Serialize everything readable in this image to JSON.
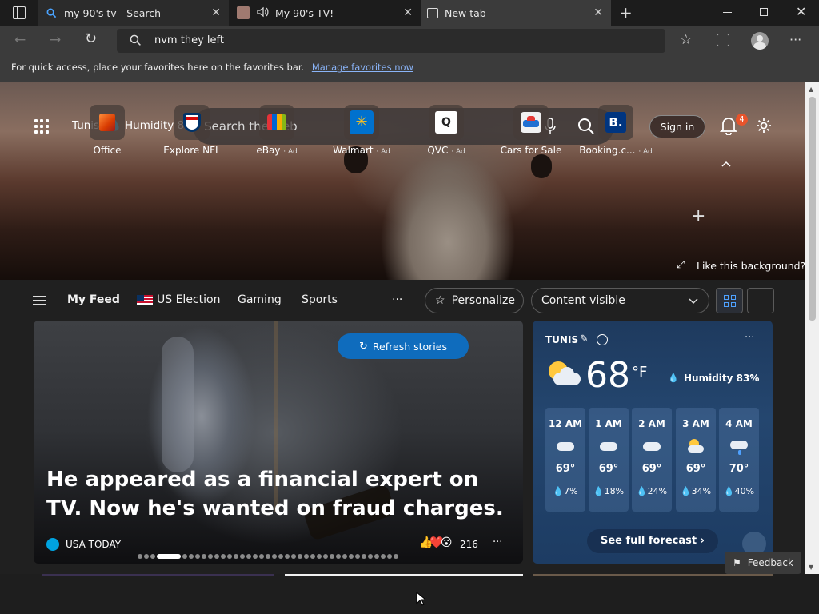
{
  "browser": {
    "tabs": [
      {
        "label": "my 90's tv - Search",
        "active": false
      },
      {
        "label": "My 90's TV!",
        "active": false
      },
      {
        "label": "New tab",
        "active": true
      }
    ],
    "address": "nvm they left"
  },
  "favorites_bar": {
    "message": "For quick access, place your favorites here on the favorites bar.",
    "link": "Manage favorites now"
  },
  "hero": {
    "city": "Tunis",
    "humidity": "Humidity 8...",
    "search_placeholder": "Search the web",
    "sign_in": "Sign in",
    "notifications": "4",
    "like_background": "Like this background?",
    "quick_links": [
      {
        "label": "Office",
        "ad": ""
      },
      {
        "label": "Explore NFL",
        "ad": ""
      },
      {
        "label": "eBay",
        "ad": "· Ad"
      },
      {
        "label": "Walmart",
        "ad": "· Ad"
      },
      {
        "label": "QVC",
        "ad": "· Ad"
      },
      {
        "label": "Cars for Sale",
        "ad": ""
      },
      {
        "label": "Booking.c...",
        "ad": "· Ad"
      }
    ]
  },
  "feed": {
    "tabs": [
      "My Feed",
      "US Election",
      "Gaming",
      "Sports"
    ],
    "more": "···",
    "personalize": "Personalize",
    "content_visible": "Content visible"
  },
  "story": {
    "refresh": "Refresh stories",
    "headline": "He appeared as a financial expert on TV. Now he's wanted on fraud charges.",
    "source": "USA TODAY",
    "reactions": "216",
    "more": "···"
  },
  "weather": {
    "city": "TUNIS",
    "temp": "68",
    "unit": "°F",
    "humidity": "Humidity 83%",
    "hours": [
      {
        "time": "12 AM",
        "temp": "69°",
        "precip": "7%",
        "icon": "cloud-icon"
      },
      {
        "time": "1 AM",
        "temp": "69°",
        "precip": "18%",
        "icon": "cloud-icon"
      },
      {
        "time": "2 AM",
        "temp": "69°",
        "precip": "24%",
        "icon": "cloud-icon"
      },
      {
        "time": "3 AM",
        "temp": "69°",
        "precip": "34%",
        "icon": "partly-cloudy-icon"
      },
      {
        "time": "4 AM",
        "temp": "70°",
        "precip": "40%",
        "icon": "rain-cloud-icon"
      }
    ],
    "full_forecast": "See full forecast"
  },
  "feedback": "Feedback",
  "colors": {
    "accent": "#0f6cbd",
    "badge": "#e8542c",
    "link": "#8ab4f8"
  }
}
